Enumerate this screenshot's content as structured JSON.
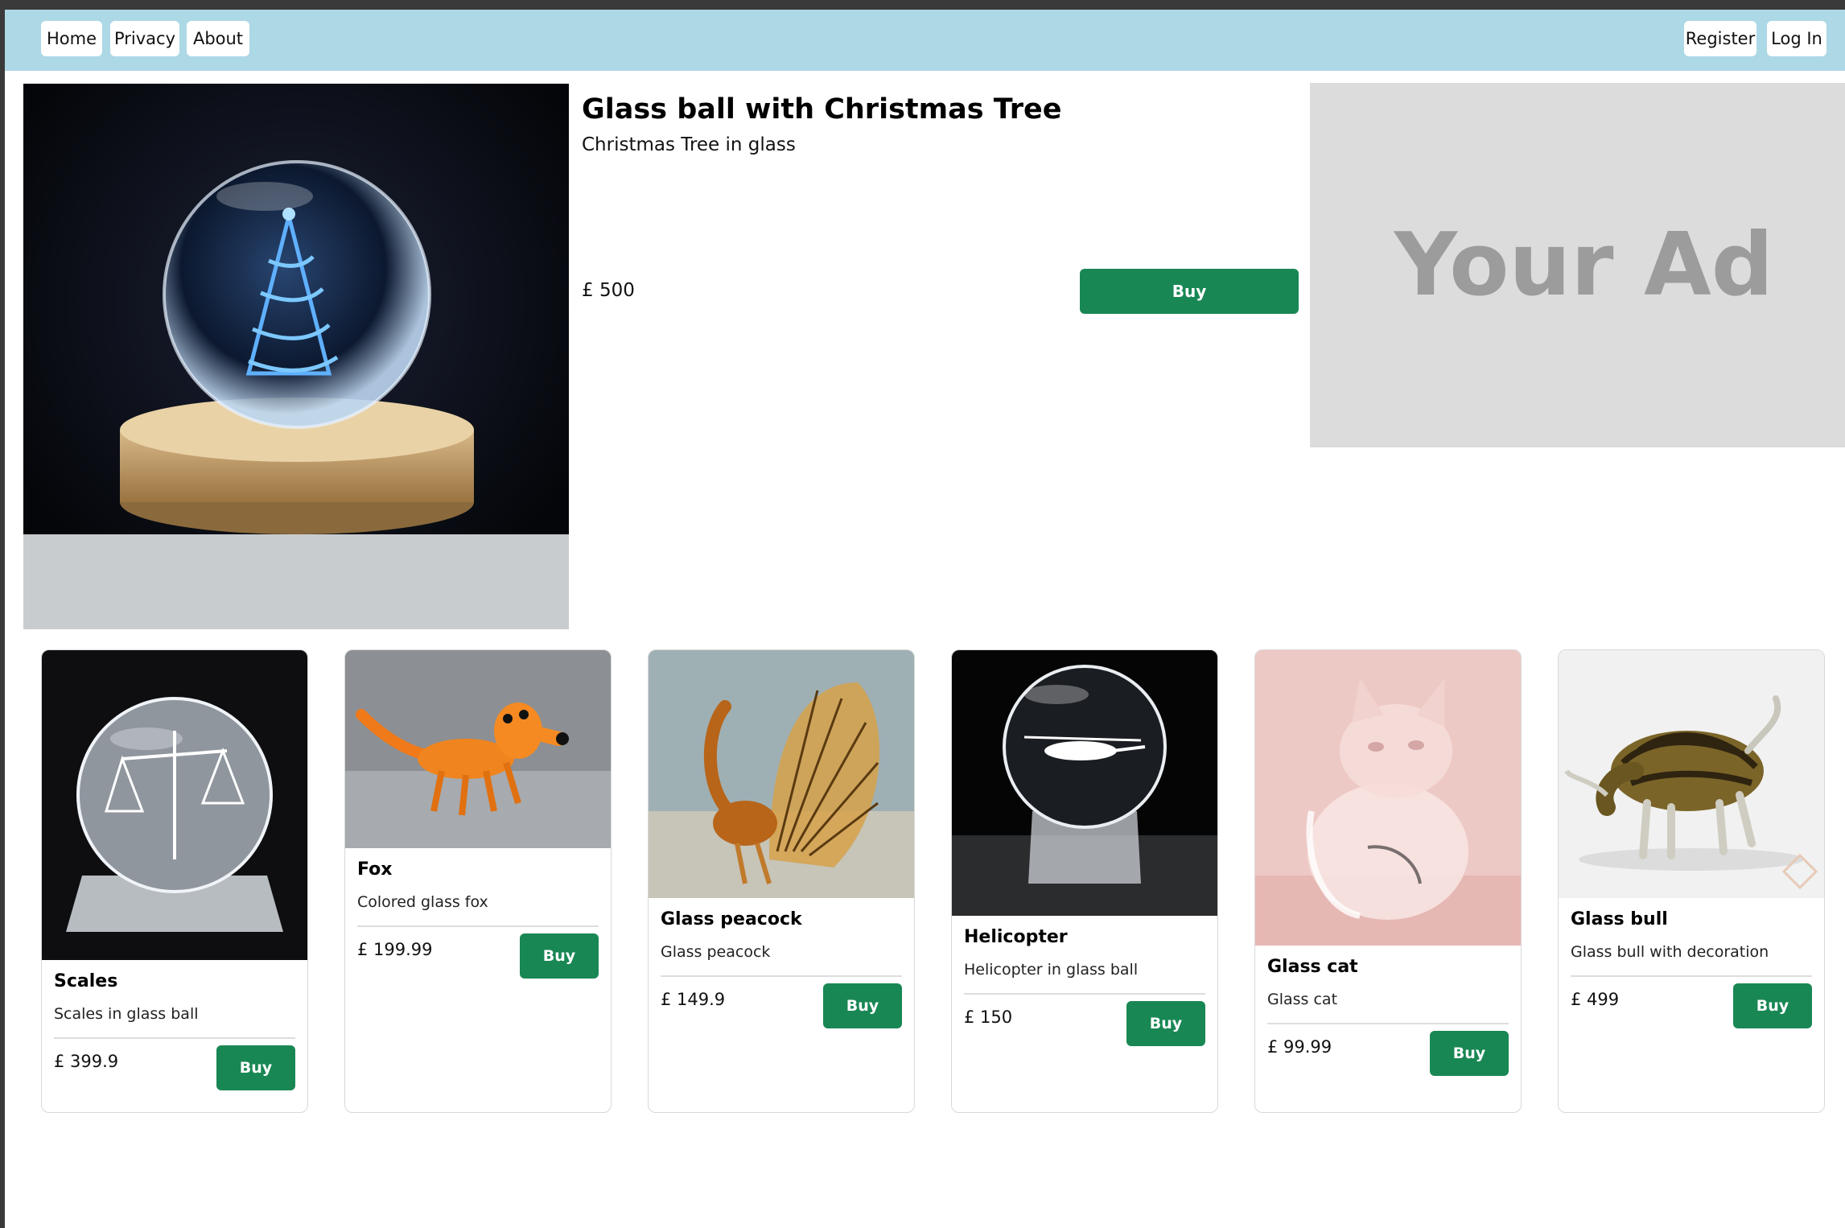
{
  "nav": {
    "home": "Home",
    "privacy": "Privacy",
    "about": "About",
    "register": "Register",
    "login": "Log In"
  },
  "featured": {
    "title": "Glass ball with Christmas Tree",
    "subtitle": "Christmas Tree in glass",
    "price": "£ 500",
    "buy_label": "Buy"
  },
  "ad": {
    "text": "Your Ad"
  },
  "products": [
    {
      "title": "Scales",
      "description": "Scales in glass ball",
      "price": "£ 399.9",
      "buy_label": "Buy"
    },
    {
      "title": "Fox",
      "description": "Colored glass fox",
      "price": "£ 199.99",
      "buy_label": "Buy"
    },
    {
      "title": "Glass peacock",
      "description": "Glass peacock",
      "price": "£ 149.9",
      "buy_label": "Buy"
    },
    {
      "title": "Helicopter",
      "description": "Helicopter in glass ball",
      "price": "£ 150",
      "buy_label": "Buy"
    },
    {
      "title": "Glass cat",
      "description": "Glass cat",
      "price": "£ 99.99",
      "buy_label": "Buy"
    },
    {
      "title": "Glass bull",
      "description": "Glass bull with decoration",
      "price": "£ 499",
      "buy_label": "Buy"
    }
  ],
  "colors": {
    "navbar": "#add8e6",
    "buy_button": "#198754",
    "ad_background": "#dcdcdc",
    "ad_text": "#9c9c9c"
  }
}
